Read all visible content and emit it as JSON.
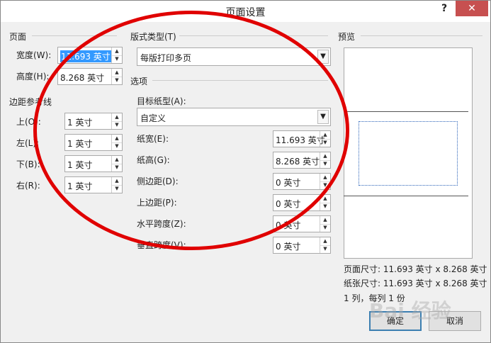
{
  "dialog": {
    "title": "页面设置",
    "help": "?",
    "close": "✕"
  },
  "page_section": {
    "heading": "页面",
    "width_label": "宽度(W):",
    "width_value": "11.693 英寸",
    "height_label": "高度(H):",
    "height_value": "8.268 英寸"
  },
  "margin_section": {
    "heading": "边距参考线",
    "top_label": "上(O):",
    "top_value": "1 英寸",
    "left_label": "左(L):",
    "left_value": "1 英寸",
    "bottom_label": "下(B):",
    "bottom_value": "1 英寸",
    "right_label": "右(R):",
    "right_value": "1 英寸"
  },
  "layout_type": {
    "heading": "版式类型(T)",
    "value": "每版打印多页"
  },
  "options": {
    "heading": "选项",
    "target_paper_label": "目标纸型(A):",
    "target_paper_value": "自定义",
    "paper_width_label": "纸宽(E):",
    "paper_width_value": "11.693 英寸",
    "paper_height_label": "纸高(G):",
    "paper_height_value": "8.268 英寸",
    "side_margin_label": "侧边距(D):",
    "side_margin_value": "0 英寸",
    "top_margin_label": "上边距(P):",
    "top_margin_value": "0 英寸",
    "h_gap_label": "水平跨度(Z):",
    "h_gap_value": "0 英寸",
    "v_gap_label": "垂直跨度(V):",
    "v_gap_value": "0 英寸"
  },
  "preview": {
    "heading": "预览",
    "page_size": "页面尺寸: 11.693 英寸 x 8.268 英寸",
    "paper_size": "纸张尺寸: 11.693 英寸 x 8.268 英寸",
    "grid_info": "1 列，每列 1 份"
  },
  "buttons": {
    "ok": "确定",
    "cancel": "取消"
  },
  "watermark": {
    "text": "Bai 经验"
  },
  "colors": {
    "annotation_ring": "#e00000",
    "selection": "#3399ff",
    "close_button": "#c75050"
  }
}
